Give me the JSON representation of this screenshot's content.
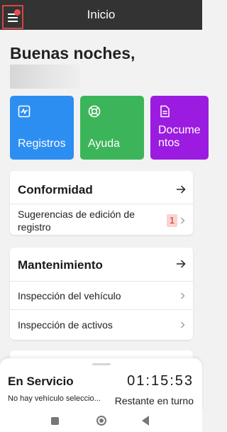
{
  "app_bar": {
    "title": "Inicio"
  },
  "greeting": "Buenas noches,",
  "tiles": [
    {
      "label": "Registros",
      "icon": "chart-icon",
      "color": "#2d8ef2"
    },
    {
      "label": "Ayuda",
      "icon": "lifebuoy-icon",
      "color": "#3cb55a"
    },
    {
      "label": "Documentos",
      "label_line1": "Docume",
      "label_line2": "ntos",
      "icon": "document-icon",
      "color": "#9b1ce0"
    }
  ],
  "conformidad_card": {
    "title": "Conformidad",
    "rows": [
      {
        "label_line1": "Sugerencias de edición de",
        "label_line2": "registro",
        "badge": "1"
      }
    ]
  },
  "mantenimiento_card": {
    "title": "Mantenimiento",
    "rows": [
      {
        "label": "Inspección del vehículo"
      },
      {
        "label": "Inspección de activos"
      }
    ]
  },
  "status_sheet": {
    "title": "En Servicio",
    "subtitle": "No hay vehículo seleccio...",
    "timer": "01:15:53",
    "timer_label": "Restante en turno"
  },
  "colors": {
    "app_bar": "#333333",
    "menu_highlight": "#d64541",
    "badge_bg": "#fbd3d0",
    "badge_text": "#c9332c"
  }
}
